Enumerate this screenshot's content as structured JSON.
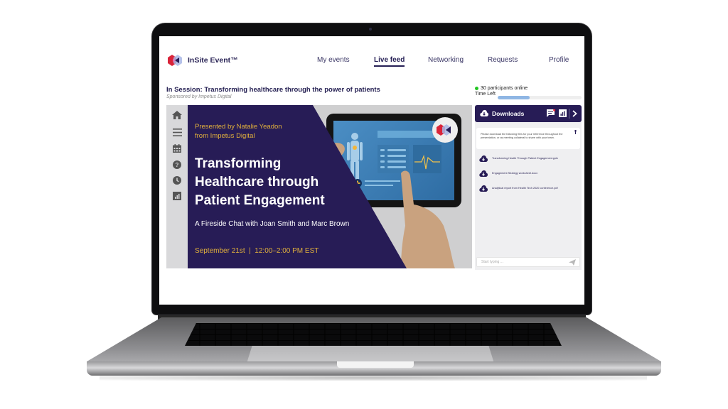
{
  "app": {
    "name": "InSite Event™",
    "brand_colors": {
      "primary": "#271c56",
      "accent": "#e2b13c",
      "online": "#22c522",
      "progress": "#8fb6e4"
    }
  },
  "nav": {
    "items": [
      {
        "label": "My events",
        "active": false
      },
      {
        "label": "Live feed",
        "active": true
      },
      {
        "label": "Networking",
        "active": false
      },
      {
        "label": "Requests",
        "active": false
      },
      {
        "label": "Profile",
        "active": false
      }
    ]
  },
  "session": {
    "title": "In Session: Transforming healthcare through the power of patients",
    "sponsor": "Sponsored by Impetus Digital"
  },
  "status": {
    "participants_online": "30 participants online",
    "time_left_label": "Time Left",
    "time_elapsed_fraction": 0.38
  },
  "sidebar_icons": [
    "home-icon",
    "menu-icon",
    "calendar-icon",
    "help-icon",
    "clock-icon",
    "chart-icon"
  ],
  "slide": {
    "presenter_line1": "Presented by Natalie Yeadon",
    "presenter_line2": "from Impetus Digital",
    "title_line1": "Transforming",
    "title_line2": "Healthcare through",
    "title_line3": "Patient Engagement",
    "subtitle": "A Fireside Chat with Joan Smith and Marc Brown",
    "date": "September 21st  |  12:00–2:00 PM EST"
  },
  "panel": {
    "title": "Downloads",
    "notice": "Please download the following files for your reference throughout the presentation, or as meeting collateral to share with your team.",
    "files": [
      {
        "name": "Transforming Health Through Patient Engagement.pptx"
      },
      {
        "name": "Engagement Strategy worksheet.docx"
      },
      {
        "name": "Analytical report from Health Tech 2020 conference.pdf"
      }
    ],
    "chat_placeholder": "Start typing ..."
  }
}
